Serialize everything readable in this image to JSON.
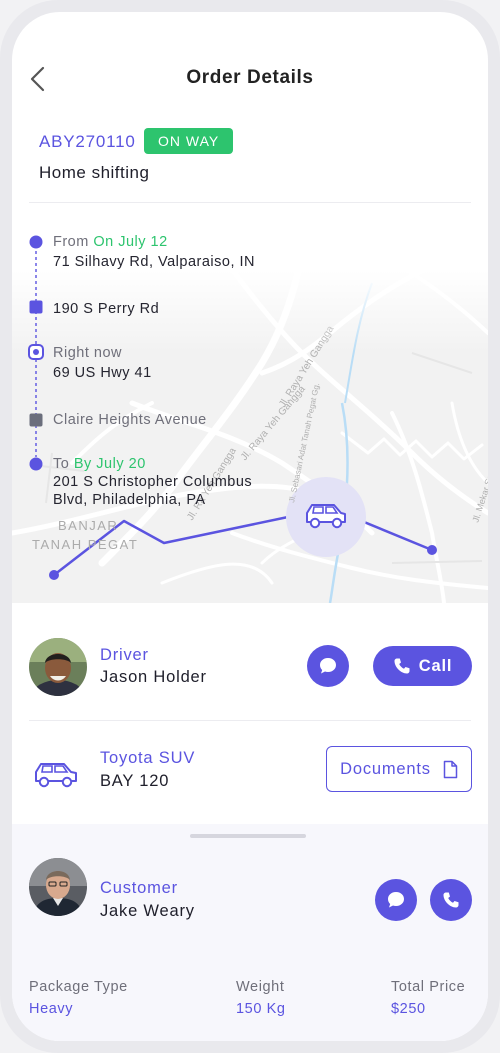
{
  "header": {
    "title": "Order Details"
  },
  "order": {
    "id": "ABY270110",
    "status": "ON WAY",
    "type": "Home shifting"
  },
  "route": {
    "from_prefix": "From",
    "from_date": "On July 12",
    "from_address": "71 Silhavy Rd, Valparaiso, IN",
    "stop1": "190 S Perry Rd",
    "now_label": "Right now",
    "now_address": "69 US Hwy 41",
    "stop2": "Claire Heights Avenue",
    "to_prefix": "To",
    "to_date": "By July 20",
    "to_address_line1": "201 S Christopher Columbus",
    "to_address_line2": "Blvd, Philadelphia, PA"
  },
  "map": {
    "labels": {
      "banjar_1": "BANJAR",
      "banjar_2": "TANAH PEGAT",
      "road1": "Jl. Raya Yeh Gangga",
      "road2": "Jl. Ra Yeh Gangga",
      "road3": "Jl. Raya Yeh Gangga",
      "road4": "Jl. Sebasari Adat Tanah Pegat Gg.",
      "road5": "Jl. Mekar Sari"
    }
  },
  "driver": {
    "role": "Driver",
    "name": "Jason Holder",
    "call_label": "Call"
  },
  "vehicle": {
    "model": "Toyota SUV",
    "plate": "BAY 120",
    "documents_label": "Documents"
  },
  "customer": {
    "role": "Customer",
    "name": "Jake Weary"
  },
  "summary": {
    "package_label": "Package Type",
    "package_value": "Heavy",
    "weight_label": "Weight",
    "weight_value": "150 Kg",
    "price_label": "Total Price",
    "price_value": "$250"
  },
  "colors": {
    "accent": "#5b54e0",
    "success": "#2dc46e"
  }
}
